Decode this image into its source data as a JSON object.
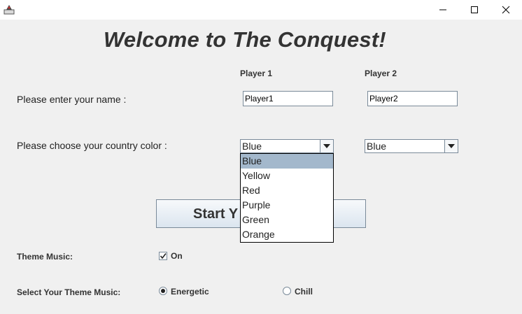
{
  "window": {
    "icons": {
      "app": "java-app-icon",
      "minimize": "minimize-icon",
      "maximize": "maximize-icon",
      "close": "close-icon"
    }
  },
  "title": "Welcome to The Conquest!",
  "columns": {
    "player1": "Player 1",
    "player2": "Player 2"
  },
  "name_row": {
    "label": "Please enter your name :",
    "player1_value": "Player1",
    "player2_value": "Player2"
  },
  "color_row": {
    "label": "Please choose your country color :",
    "player1_selected": "Blue",
    "player2_selected": "Blue"
  },
  "dropdown": {
    "options": [
      "Blue",
      "Yellow",
      "Red",
      "Purple",
      "Green",
      "Orange"
    ],
    "highlighted": "Blue"
  },
  "start_button": {
    "label_visible": "Start Y"
  },
  "music": {
    "label": "Theme Music:",
    "checkbox_label": "On",
    "checked": true
  },
  "theme": {
    "label": "Select Your Theme Music:",
    "options": [
      "Energetic",
      "Chill"
    ],
    "selected": "Energetic"
  }
}
